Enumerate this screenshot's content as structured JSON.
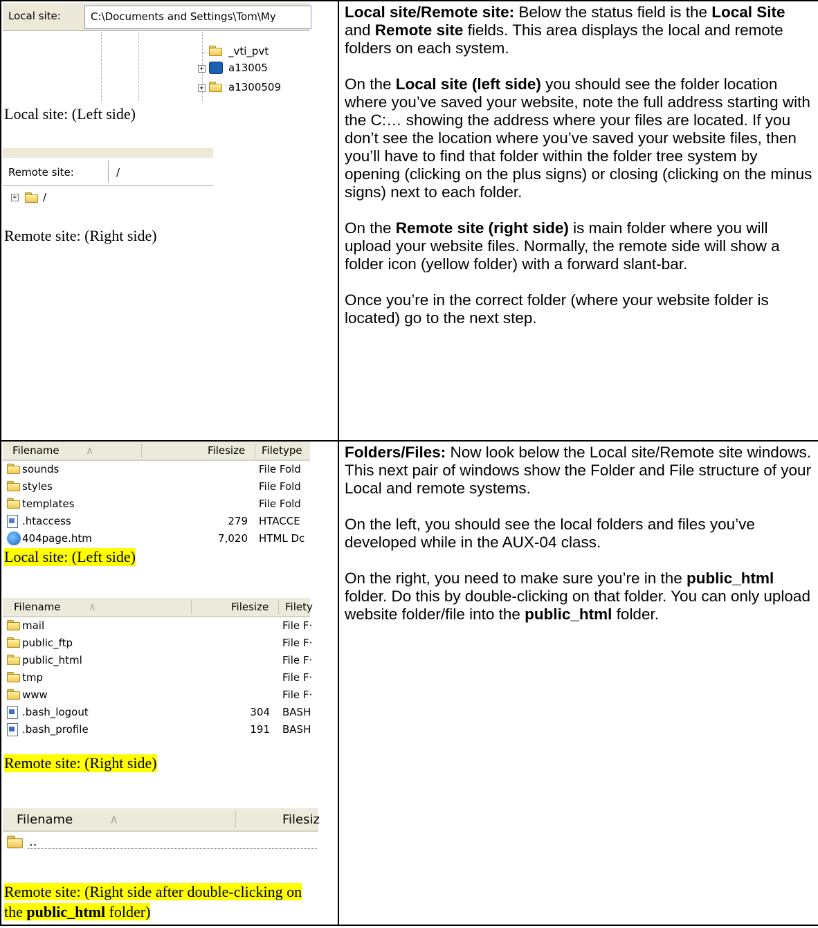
{
  "row1": {
    "local_panel": {
      "label": "Local site:",
      "path": "C:\\Documents and Settings\\Tom\\My",
      "tree_items": [
        "_vti_pvt",
        "a13005",
        "a1300509"
      ],
      "caption": "Local site: (Left side)"
    },
    "remote_panel": {
      "label": "Remote site:",
      "path": "/",
      "tree_item": "/",
      "caption": "Remote site: (Right side)"
    },
    "paragraphs": {
      "p1_bold_a": "Local site/Remote site:",
      "p1_text_a": "  Below the status field is the ",
      "p1_bold_b": "Local Site",
      "p1_text_b": " and ",
      "p1_bold_c": "Remote site",
      "p1_text_c": " fields.  This area displays the local and remote folders on each system.",
      "p2_text_a": "On the ",
      "p2_bold_a": "Local site (left side)",
      "p2_text_b": " you should see the folder location where you’ve saved your website, note the full address starting with the C:… showing the address where your files are located.  If you don’t see the location where you’ve saved your website files, then you’ll have to find that folder within the folder tree system by opening (clicking on the plus signs) or closing (clicking on the minus signs) next to each folder.",
      "p3_text_a": "On the ",
      "p3_bold_a": "Remote site (right side)",
      "p3_text_b": " is main folder where you will upload your website files.  Normally, the remote side will show a folder icon (yellow folder) with a forward slant-bar.",
      "p4_text": "Once you’re in the correct folder (where your website folder is located) go to the next step."
    }
  },
  "row2": {
    "local_list": {
      "headers": [
        "Filename",
        "Filesize",
        "Filetype"
      ],
      "rows": [
        {
          "name": "sounds",
          "size": "",
          "type": "File Fold",
          "icon": "folder-icon"
        },
        {
          "name": "styles",
          "size": "",
          "type": "File Fold",
          "icon": "folder-icon"
        },
        {
          "name": "templates",
          "size": "",
          "type": "File Fold",
          "icon": "folder-icon"
        },
        {
          "name": ".htaccess",
          "size": "279",
          "type": "HTACCE",
          "icon": "file-icon"
        },
        {
          "name": "404page.htm",
          "size": "7,020",
          "type": "HTML Dc",
          "icon": "ie-page-icon"
        }
      ],
      "caption": "Local site: (Left side)"
    },
    "remote_list": {
      "headers": [
        "Filename",
        "Filesize",
        "Filety"
      ],
      "rows": [
        {
          "name": "mail",
          "size": "",
          "type": "File F·",
          "icon": "folder-icon"
        },
        {
          "name": "public_ftp",
          "size": "",
          "type": "File F·",
          "icon": "folder-icon"
        },
        {
          "name": "public_html",
          "size": "",
          "type": "File F·",
          "icon": "folder-icon"
        },
        {
          "name": "tmp",
          "size": "",
          "type": "File F·",
          "icon": "folder-icon"
        },
        {
          "name": "www",
          "size": "",
          "type": "File F·",
          "icon": "folder-icon"
        },
        {
          "name": ".bash_logout",
          "size": "304",
          "type": "BASH",
          "icon": "script-file-icon"
        },
        {
          "name": ".bash_profile",
          "size": "191",
          "type": "BASH",
          "icon": "script-file-icon"
        }
      ],
      "caption": "Remote site: (Right side)"
    },
    "remote_list_after": {
      "headers": [
        "Filename",
        "Filesiz"
      ],
      "row_name": "..",
      "caption_a": "Remote site: (Right side after double-clicking on the ",
      "caption_bold": "public_html",
      "caption_b": " folder)"
    },
    "paragraphs": {
      "p1_bold": "Folders/Files:",
      "p1_text": "  Now look below the Local site/Remote site windows.  This next pair of windows show the Folder and File structure of your Local and remote systems.",
      "p2_text": "On the left, you should see the local folders and files you’ve developed while in the AUX-04 class.",
      "p3_text_a": "On the right, you need to make sure you’re in the ",
      "p3_bold_a": "public_html",
      "p3_text_b": " folder.  Do this by double-clicking on that folder.  You can only upload website folder/file into the ",
      "p3_bold_b": "public_html",
      "p3_text_c": " folder."
    }
  },
  "colors": {
    "highlight": "#ffff00",
    "folder": "#f0c850",
    "xp_header": "#ebeadb"
  }
}
